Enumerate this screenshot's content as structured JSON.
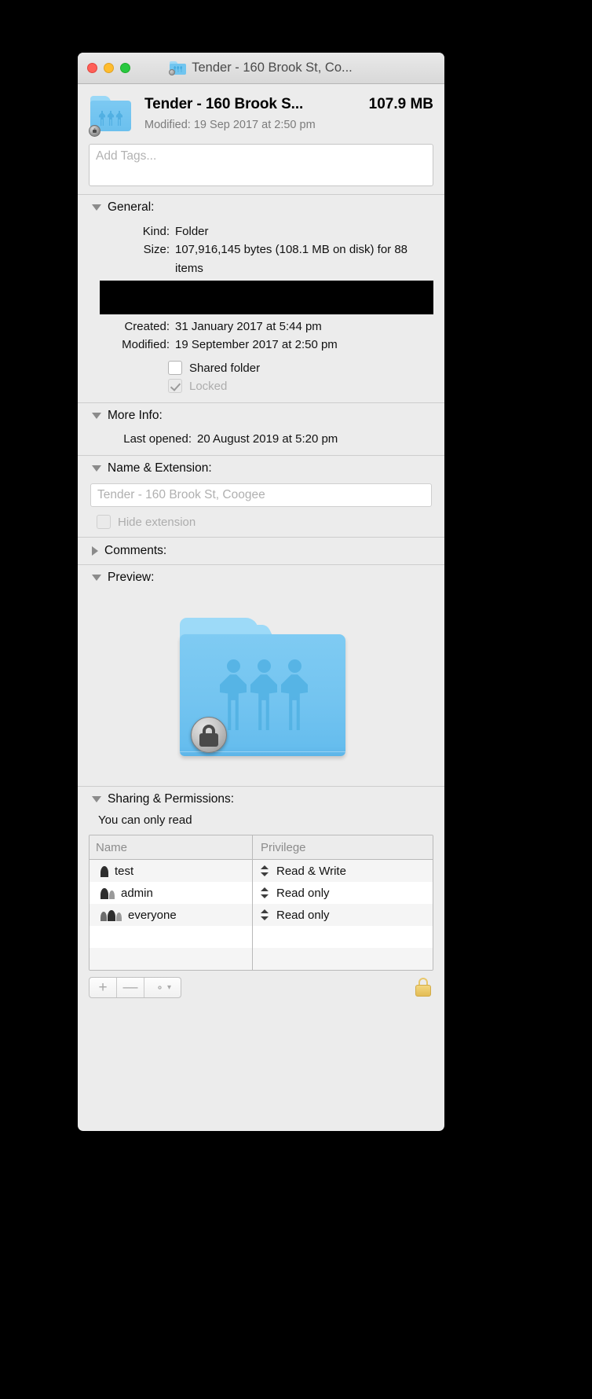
{
  "window": {
    "title": "Tender - 160 Brook St, Co...",
    "title_icon": "shared-folder-icon"
  },
  "traffic_lights": {
    "close": "close-button",
    "minimize": "minimize-button",
    "zoom": "zoom-button"
  },
  "header": {
    "name": "Tender - 160 Brook S...",
    "size": "107.9 MB",
    "modified": "Modified: 19 Sep 2017 at 2:50 pm"
  },
  "tags": {
    "placeholder": "Add Tags..."
  },
  "sections": {
    "general": {
      "title": "General:",
      "expanded": true,
      "rows": [
        {
          "label": "Kind:",
          "value": "Folder"
        },
        {
          "label": "Size:",
          "value": "107,916,145 bytes (108.1 MB on disk) for 88 items"
        }
      ],
      "redacted_row": true,
      "rows2": [
        {
          "label": "Created:",
          "value": "31 January 2017 at 5:44 pm"
        },
        {
          "label": "Modified:",
          "value": "19 September 2017 at 2:50 pm"
        }
      ],
      "checkboxes": [
        {
          "label": "Shared folder",
          "checked": false,
          "disabled": false
        },
        {
          "label": "Locked",
          "checked": true,
          "disabled": true
        }
      ]
    },
    "more_info": {
      "title": "More Info:",
      "expanded": true,
      "label": "Last opened:",
      "value": "20 August 2019 at 5:20 pm"
    },
    "name_extension": {
      "title": "Name & Extension:",
      "expanded": true,
      "field_value": "Tender - 160 Brook St, Coogee",
      "hide_extension_label": "Hide extension",
      "hide_extension_checked": false
    },
    "comments": {
      "title": "Comments:",
      "expanded": false
    },
    "preview": {
      "title": "Preview:",
      "expanded": true,
      "icon": "shared-folder-locked-icon"
    },
    "sharing": {
      "title": "Sharing & Permissions:",
      "expanded": true,
      "note": "You can only read",
      "columns": [
        "Name",
        "Privilege"
      ],
      "rows": [
        {
          "icon": "single-user-icon",
          "name": "test",
          "privilege": "Read & Write"
        },
        {
          "icon": "two-users-icon",
          "name": "admin",
          "privilege": "Read only"
        },
        {
          "icon": "three-users-icon",
          "name": "everyone",
          "privilege": "Read only"
        }
      ],
      "toolbar": {
        "add": "+",
        "remove": "—",
        "action": "gear-icon",
        "lock": "lock-icon"
      }
    }
  },
  "colors": {
    "window_bg": "#ececec",
    "folder_blue": "#73c4f0",
    "redaction": "#000000",
    "accent_lock": "#e8c76a"
  }
}
